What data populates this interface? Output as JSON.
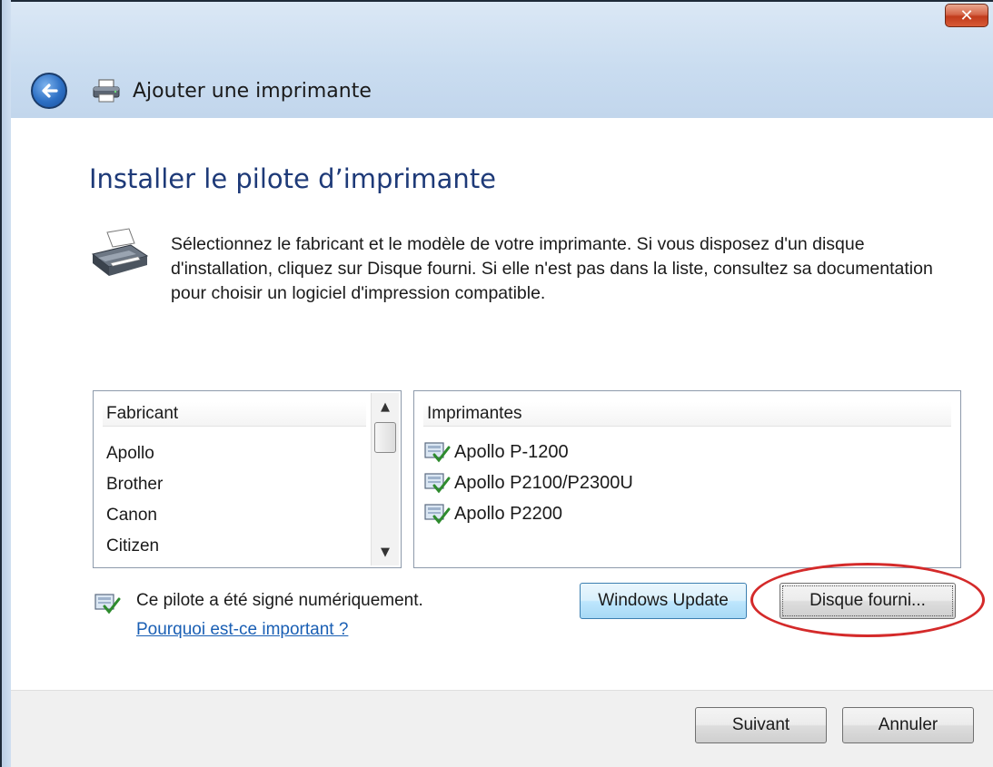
{
  "window": {
    "title": "Ajouter une imprimante",
    "close_label": "✕"
  },
  "page": {
    "heading": "Installer le pilote d’imprimante",
    "description": "Sélectionnez le fabricant et le modèle de votre imprimante. Si vous disposez d'un disque d'installation, cliquez sur Disque fourni. Si elle n'est pas dans la liste, consultez sa documentation pour choisir un logiciel d'impression compatible."
  },
  "manufacturers": {
    "header": "Fabricant",
    "items": [
      "Apollo",
      "Brother",
      "Canon",
      "Citizen"
    ]
  },
  "printers": {
    "header": "Imprimantes",
    "items": [
      "Apollo P-1200",
      "Apollo P2100/P2300U",
      "Apollo P2200"
    ]
  },
  "signature": {
    "text": "Ce pilote a été signé numériquement.",
    "link": "Pourquoi est-ce important ?"
  },
  "buttons": {
    "windows_update": "Windows Update",
    "have_disk": "Disque fourni...",
    "next": "Suivant",
    "cancel": "Annuler"
  },
  "colors": {
    "accent_highlight": "#d42a2a",
    "heading": "#1e3a78",
    "link": "#1a5fb4"
  }
}
